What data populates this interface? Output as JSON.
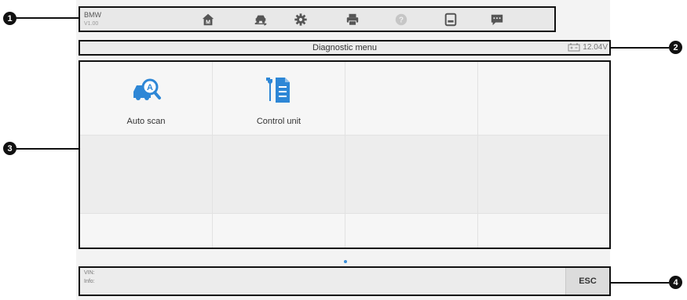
{
  "toolbar": {
    "app_name": "BMW",
    "app_version": "V1.00",
    "buttons": [
      {
        "icon": "home-icon"
      },
      {
        "icon": "vehicle-swap-icon"
      },
      {
        "icon": "settings-gear-icon"
      },
      {
        "icon": "printer-icon"
      },
      {
        "icon": "help-icon",
        "disabled": true
      },
      {
        "icon": "save-icon"
      },
      {
        "icon": "data-logging-icon"
      }
    ]
  },
  "titlebar": {
    "title": "Diagnostic menu",
    "battery_voltage": "12.04V"
  },
  "menu": {
    "tiles": [
      {
        "label": "Auto scan",
        "icon": "auto-scan-icon"
      },
      {
        "label": "Control unit",
        "icon": "control-unit-icon"
      }
    ]
  },
  "statusbar": {
    "vin_label": "VIN:",
    "info_label": "Info:",
    "esc_label": "ESC"
  },
  "callouts": [
    "1",
    "2",
    "3",
    "4"
  ],
  "colors": {
    "accent_blue": "#3b8fd9",
    "callout_black": "#111111"
  }
}
